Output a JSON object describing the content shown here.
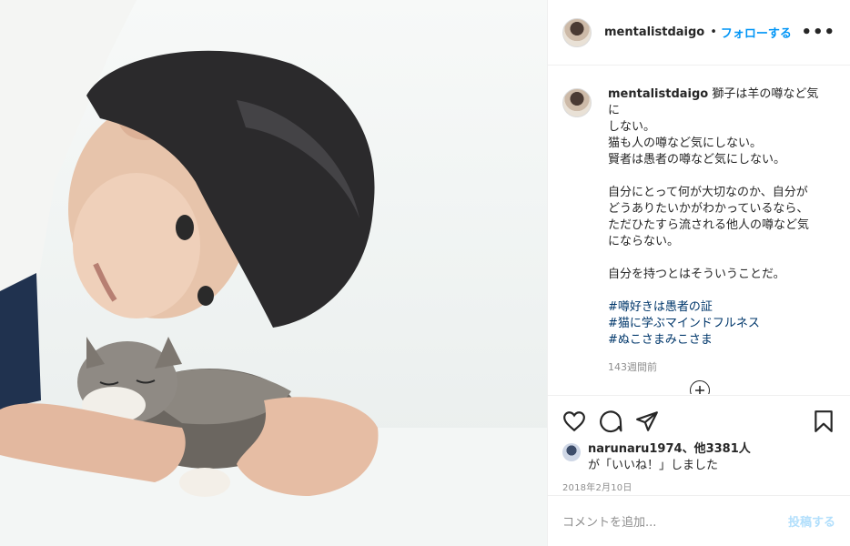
{
  "post": {
    "username": "mentalistdaigo",
    "dot": "•",
    "follow_label": "フォローする",
    "more_label": "•••",
    "caption_lines": [
      "獅子は羊の噂など気に\nしない。\n猫も人の噂など気にしない。\n賢者は愚者の噂など気にしない。\n\n自分にとって何が大切なのか、自分が\nどうありたいかがわかっているなら、\nただひたすら流される他人の噂など気\nにならない。\n\n自分を持つとはそういうことだ。"
    ],
    "hashtags": [
      "#噂好きは愚者の証",
      "#猫に学ぶマインドフルネス",
      "#ぬこさまみこさま"
    ],
    "time_ago": "143週間前",
    "load_more_icon": "plus-circle-icon",
    "likes_user": "narunaru1974",
    "likes_rest": "、他3381人",
    "likes_suffix": "が「いいね！」しました",
    "date": "2018年2月10日",
    "comment_placeholder": "コメントを追加...",
    "post_label": "投稿する"
  },
  "icons": {
    "like": "heart-icon",
    "comment": "comment-icon",
    "share": "paper-plane-icon",
    "save": "bookmark-icon"
  },
  "colors": {
    "accent": "#0095f6",
    "hashtag": "#00376b",
    "muted": "#8e8e8e",
    "post_disabled": "#b2dffc"
  }
}
